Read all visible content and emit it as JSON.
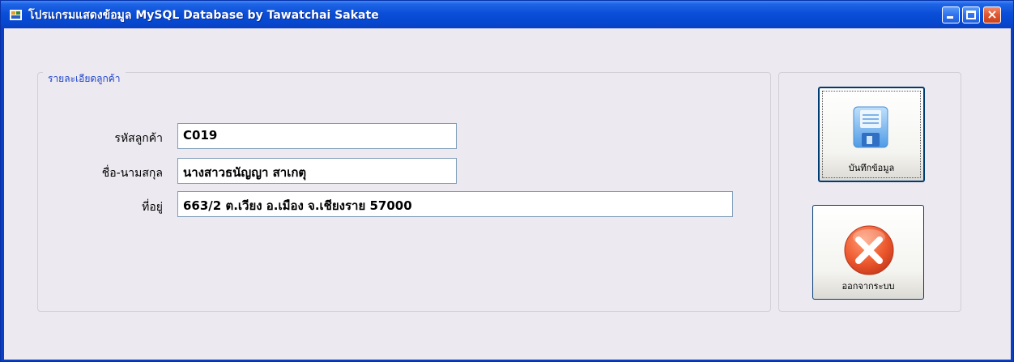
{
  "window": {
    "title": "โปรแกรมแสดงข้อมูล MySQL Database  by Tawatchai Sakate",
    "controls": {
      "minimize": "minimize",
      "maximize": "maximize",
      "close": "×"
    }
  },
  "customer_group": {
    "legend": "รายละเอียดลูกค้า",
    "fields": [
      {
        "label": "รหัสลูกค้า",
        "value": "C019"
      },
      {
        "label": "ชื่อ-นามสกุล",
        "value": "นางสาวธนัญญา  สาเกตุ"
      },
      {
        "label": "ที่อยู่",
        "value": "663/2 ต.เวียง  อ.เมือง จ.เชียงราย 57000"
      }
    ]
  },
  "actions": {
    "save_label": "บันทึกข้อมูล",
    "exit_label": "ออกจากระบบ"
  },
  "icons": {
    "save": "floppy-disk-icon",
    "exit": "red-x-icon"
  },
  "colors": {
    "titlebar": "#0648cf",
    "client_bg": "#ece9f0",
    "legend_text": "#1f45c8",
    "exit_icon": "#e8542f"
  }
}
